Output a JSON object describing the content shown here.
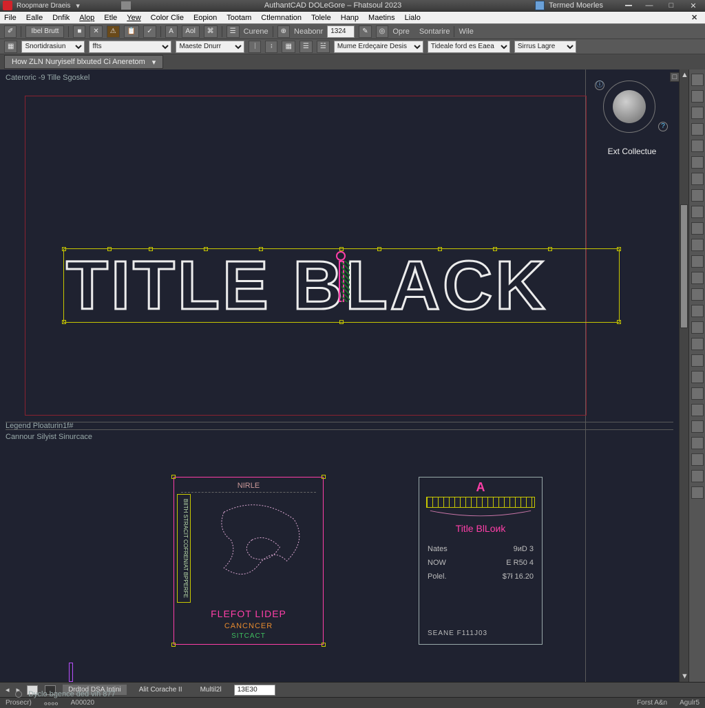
{
  "titlebar": {
    "doc_title": "AuthantCAD DOLeGore – Fhatsoul 2023",
    "quick_group": "Termed Moerles",
    "quick_left": "Roopmare  Draeis",
    "min": "—",
    "max": "□",
    "close": "✕"
  },
  "menu": {
    "items": [
      "File",
      "Ealle",
      "Dnfik",
      "Alop",
      "Etle",
      "Yew",
      "Color Clie",
      "Eopion",
      "Tootam",
      "Ctlemnation",
      "Tolele",
      "Hanp",
      "Maetins",
      "Lialo"
    ]
  },
  "ribbon1": {
    "btn1": "Ibel Brutt",
    "btn2": "■",
    "btn_x": "✕",
    "btn_warn": "⚠",
    "btn_paste": "📋",
    "btn_a": "A",
    "btn_ad": "Aol",
    "btn_c": "⌘",
    "crene": "Curene",
    "neabonr": "Neabonr",
    "neabonr_val": "1324",
    "pencil": "✎",
    "target": "◎",
    "opre": "Opre",
    "sontarire": "Sontarire",
    "wile": "Wile"
  },
  "ribbon2": {
    "sel1": "Snortidrasiun",
    "sel2": "ffts",
    "sel3": "Maeste Dnurr",
    "i1": "ᛁ",
    "i2": "፧",
    "i3": "▦",
    "i4": "☰",
    "i5": "☱",
    "sel4": "Mume Erdeçaire Desis",
    "sel5": "Tideale ford es Eaea",
    "sel6": "Sirrus Lagre"
  },
  "doctab": {
    "label": "How  ZLN Nuryiself blxuted Сi Aneretom",
    "chev": "▾"
  },
  "viewports": {
    "top_label": "Cateroric -9 Tille Sgoskel",
    "legend": "Legend Ploaturin1f#",
    "lower_label": "Cannour Silyist Sinurcace"
  },
  "title_object": {
    "text": "TITLE  BLACK"
  },
  "viewcube": {
    "label": "Ext Collectue",
    "home": "ⓘ",
    "opt": "?"
  },
  "tblock_a": {
    "head": "NIRLE",
    "side": "BIITH STRACIT  COFRENIAT  BPPERFE",
    "foot1": "FLEFOT  LIDEP",
    "foot2": "CANCNCER",
    "foot3": "SITCACT"
  },
  "tblock_b": {
    "logo": "A",
    "name": "Title BlLoиk",
    "row1_k": "Nates",
    "row1_v": "9иD 3",
    "row2_k": "NOW",
    "row2_v": "E R50 4",
    "row3_k": "Polel.",
    "row3_v": "$7ł 16.20",
    "scale": "SEANE  F111J03"
  },
  "hint": "Dyclo bgence ded  vih 877",
  "layout_tabs": {
    "t1": "Drdtod DSA  Intini",
    "t2": "Alit Corache  II",
    "t3": "Multil2l",
    "input": "13E30"
  },
  "status": {
    "s1": "Prosecr)",
    "s2": "००००",
    "s3": "А00020",
    "s4": "Forst A&n",
    "s5": "Agulr5"
  },
  "side_tool_count": 26
}
